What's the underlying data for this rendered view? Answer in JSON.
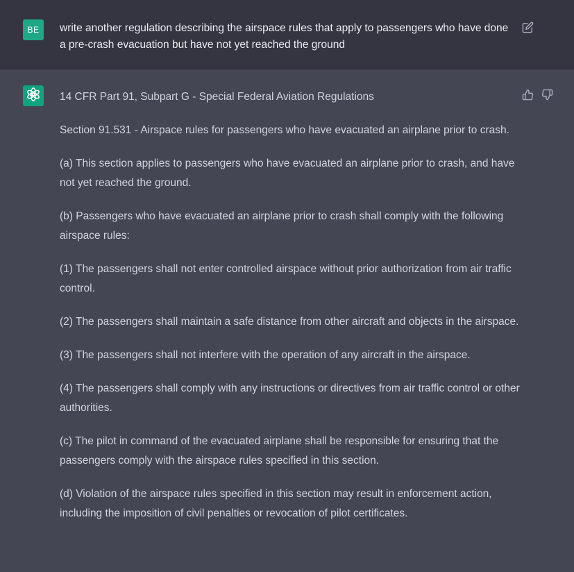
{
  "user_message": {
    "avatar_initials": "BE",
    "avatar_color": "#1ea886",
    "text": "write another regulation describing the airspace rules that apply to passengers who have done a pre-crash evacuation but have not yet reached the ground",
    "edit_icon": "edit-icon"
  },
  "assistant_message": {
    "avatar_icon": "openai-logo-icon",
    "avatar_color": "#10a37f",
    "feedback_icons": [
      "thumbs-up-icon",
      "thumbs-down-icon"
    ],
    "paragraphs": [
      "14 CFR Part 91, Subpart G - Special Federal Aviation Regulations",
      "Section 91.531 - Airspace rules for passengers who have evacuated an airplane prior to crash.",
      "(a) This section applies to passengers who have evacuated an airplane prior to crash, and have not yet reached the ground.",
      "(b) Passengers who have evacuated an airplane prior to crash shall comply with the following airspace rules:",
      "(1) The passengers shall not enter controlled airspace without prior authorization from air traffic control.",
      "(2) The passengers shall maintain a safe distance from other aircraft and objects in the airspace.",
      "(3) The passengers shall not interfere with the operation of any aircraft in the airspace.",
      "(4) The passengers shall comply with any instructions or directives from air traffic control or other authorities.",
      "(c) The pilot in command of the evacuated airplane shall be responsible for ensuring that the passengers comply with the airspace rules specified in this section.",
      "(d) Violation of the airspace rules specified in this section may result in enforcement action, including the imposition of civil penalties or revocation of pilot certificates."
    ]
  }
}
